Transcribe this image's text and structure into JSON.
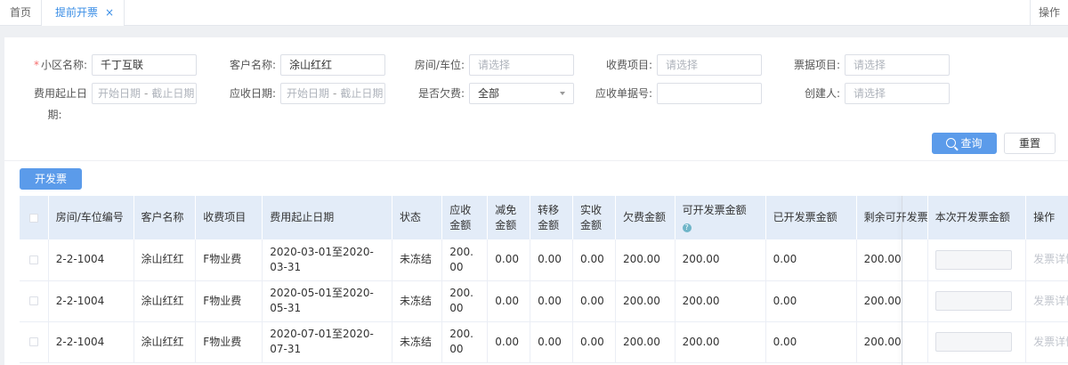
{
  "tabs": {
    "home": "首页",
    "active": "提前开票",
    "close_glyph": "×",
    "ops": "操作"
  },
  "filters": {
    "community_label": "小区名称:",
    "community_value": "千丁互联",
    "customer_label": "客户名称:",
    "customer_value": "涂山红红",
    "room_label": "房间/车位:",
    "room_placeholder": "请选择",
    "fee_item_label": "收费项目:",
    "fee_item_placeholder": "请选择",
    "bill_item_label": "票据项目:",
    "bill_item_placeholder": "请选择",
    "fee_date_label_1": "费用起止日",
    "fee_date_label_2": "期:",
    "fee_date_start": "开始日期",
    "fee_date_end": "截止日期",
    "date_sep": "-",
    "receivable_date_label": "应收日期:",
    "receivable_date_start": "开始日期",
    "receivable_date_end": "截止日期",
    "arrears_label": "是否欠费:",
    "arrears_value": "全部",
    "receivable_no_label": "应收单据号:",
    "receivable_no_value": "",
    "creator_label": "创建人:",
    "creator_placeholder": "请选择"
  },
  "actions": {
    "query": "查询",
    "reset": "重置",
    "invoice": "开发票"
  },
  "table": {
    "headers": {
      "room": "房间/车位编号",
      "customer": "客户名称",
      "fee_item": "收费项目",
      "period": "费用起止日期",
      "status": "状态",
      "receivable": "应收金额",
      "reduction": "减免金额",
      "transfer": "转移金额",
      "received": "实收金额",
      "arrears": "欠费金额",
      "invoiceable": "可开发票金额",
      "invoiced": "已开发票金额",
      "remaining": "剩余可开发票",
      "current": "本次开发票金额",
      "ops": "操作"
    },
    "rows": [
      {
        "room": "2-2-1004",
        "customer": "涂山红红",
        "fee_item": "F物业费",
        "period": "2020-03-01至2020-03-31",
        "status": "未冻结",
        "receivable": "200.00",
        "reduction": "0.00",
        "transfer": "0.00",
        "received": "0.00",
        "arrears": "200.00",
        "invoiceable": "200.00",
        "invoiced": "0.00",
        "remaining": "200.00",
        "current": "",
        "ops": "发票详情"
      },
      {
        "room": "2-2-1004",
        "customer": "涂山红红",
        "fee_item": "F物业费",
        "period": "2020-05-01至2020-05-31",
        "status": "未冻结",
        "receivable": "200.00",
        "reduction": "0.00",
        "transfer": "0.00",
        "received": "0.00",
        "arrears": "200.00",
        "invoiceable": "200.00",
        "invoiced": "0.00",
        "remaining": "200.00",
        "current": "",
        "ops": "发票详情"
      },
      {
        "room": "2-2-1004",
        "customer": "涂山红红",
        "fee_item": "F物业费",
        "period": "2020-07-01至2020-07-31",
        "status": "未冻结",
        "receivable": "200.00",
        "reduction": "0.00",
        "transfer": "0.00",
        "received": "0.00",
        "arrears": "200.00",
        "invoiceable": "200.00",
        "invoiced": "0.00",
        "remaining": "200.00",
        "current": "",
        "ops": "发票详情"
      }
    ]
  }
}
